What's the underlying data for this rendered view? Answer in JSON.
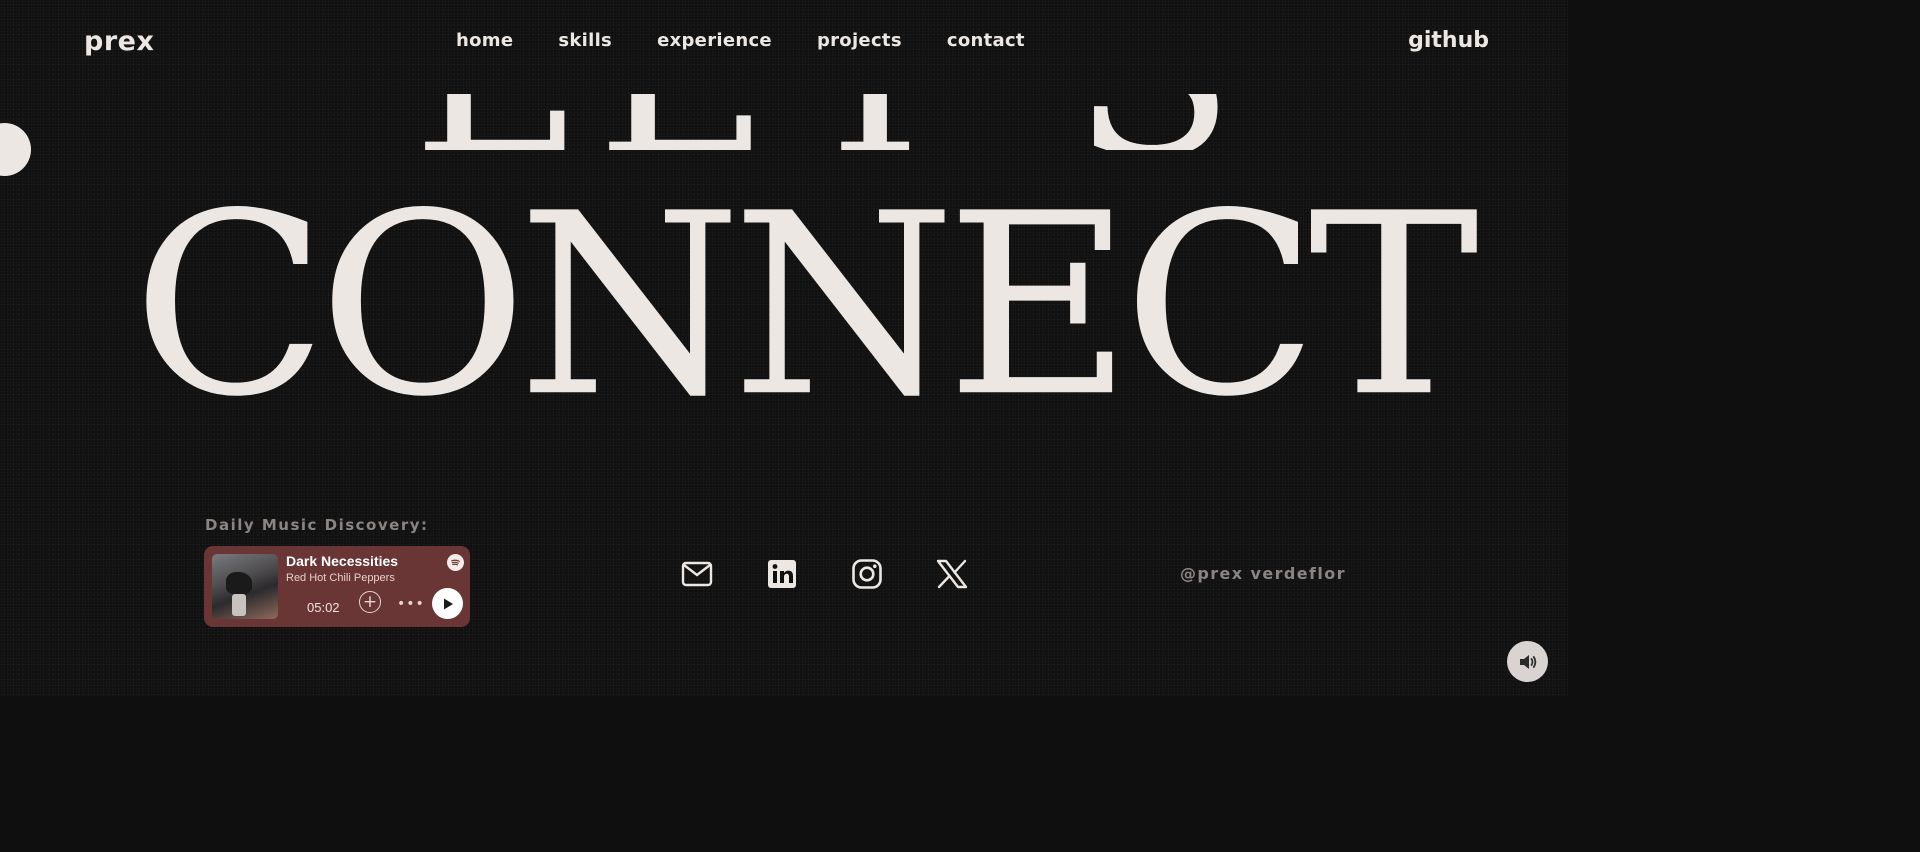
{
  "header": {
    "logo": "prex",
    "nav": [
      "home",
      "skills",
      "experience",
      "projects",
      "contact"
    ],
    "github": "github"
  },
  "hero": {
    "line1": "LET'S",
    "line2": "CONNECT"
  },
  "music": {
    "label": "Daily Music Discovery:",
    "track_title": "Dark Necessities",
    "artist": "Red Hot Chili Peppers",
    "duration": "05:02",
    "icons": [
      "album-cover",
      "spotify-icon",
      "add-icon",
      "more-icon",
      "play-icon"
    ]
  },
  "social": {
    "icons": [
      "mail-icon",
      "linkedin-icon",
      "instagram-icon",
      "x-icon"
    ]
  },
  "handle": "@prex verdeflor",
  "colors": {
    "background": "#101010",
    "text": "#ece7e3",
    "player_bg": "#6a3535",
    "muted": "#8a8582"
  }
}
